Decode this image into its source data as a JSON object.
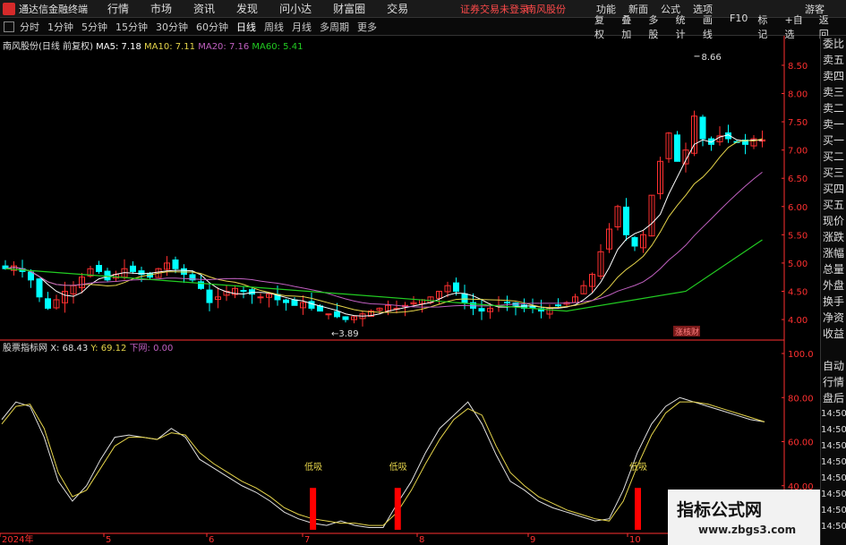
{
  "menubar": {
    "app_title": "通达信金融终端",
    "items": [
      "行情",
      "市场",
      "资讯",
      "发现",
      "问小达",
      "财富圈",
      "交易"
    ],
    "alert": "证券交易未登录",
    "stock_name": "南风股份",
    "right_items": [
      "功能",
      "新面",
      "公式",
      "选项"
    ],
    "guest": "游客"
  },
  "toolbar": {
    "periods": [
      "分时",
      "1分钟",
      "5分钟",
      "15分钟",
      "30分钟",
      "60分钟",
      "日线",
      "周线",
      "月线",
      "多周期",
      "更多"
    ],
    "active": "日线",
    "right_items": [
      "复权",
      "叠加",
      "多股",
      "统计",
      "画线",
      "F10",
      "标记",
      "+自选",
      "返回"
    ]
  },
  "main_info": {
    "name": "南风股份(日线 前复权)",
    "ma5": "MA5: 7.18",
    "ma10": "MA10: 7.11",
    "ma20": "MA20: 7.16",
    "ma60": "MA60: 5.41"
  },
  "sub_info": {
    "name": "股票指标网",
    "x": "X: 68.43",
    "y": "Y: 69.12",
    "down": "下网: 0.00"
  },
  "annotations": {
    "high_label": "8.66",
    "low_label": "3.89",
    "badge": "涨核财",
    "signal_label": "低吸"
  },
  "price_axis": [
    "8.50",
    "8.00",
    "7.50",
    "7.00",
    "6.50",
    "6.00",
    "5.50",
    "5.00",
    "4.50",
    "4.00"
  ],
  "osc_axis": [
    "100.0",
    "80.00",
    "60.00",
    "40.00"
  ],
  "date_axis": [
    "2024年",
    "5",
    "6",
    "7",
    "8",
    "9",
    "10"
  ],
  "side_panel": [
    "委比",
    "卖五",
    "卖四",
    "卖三",
    "卖二",
    "卖一",
    "买一",
    "买二",
    "买三",
    "买四",
    "买五",
    "现价",
    "涨跌",
    "涨幅",
    "总量",
    "外盘",
    "换手",
    "净资",
    "收益",
    "",
    "自动",
    "行情",
    "盘后",
    "14:50",
    "14:50",
    "14:50",
    "14:50",
    "14:50",
    "14:50",
    "14:50",
    "14:50"
  ],
  "watermark": {
    "title": "指标公式网",
    "url": "www.zbgs3.com"
  },
  "colors": {
    "up": "#ff3030",
    "down": "#00ffff",
    "ma5": "#ffffff",
    "ma10": "#e5d44a",
    "ma20": "#c060c0",
    "ma60": "#22cc22",
    "x_line": "#e0e0e0",
    "y_line": "#e5d44a",
    "signal": "#ff0000",
    "axis": "#ff3030"
  },
  "chart_data": [
    {
      "type": "candlestick",
      "title": "南风股份(日线 前复权)",
      "ylim": [
        3.7,
        8.8
      ],
      "price_high": 8.66,
      "price_low": 3.89,
      "x_labels": [
        "2024年",
        "5",
        "6",
        "7",
        "8",
        "9",
        "10"
      ],
      "closes": [
        4.9,
        4.95,
        4.85,
        4.7,
        4.4,
        4.2,
        4.35,
        4.5,
        4.6,
        4.75,
        4.9,
        4.85,
        4.7,
        4.8,
        4.9,
        4.85,
        4.8,
        4.75,
        4.9,
        5.0,
        4.9,
        4.8,
        4.7,
        4.55,
        4.3,
        4.4,
        4.5,
        4.55,
        4.5,
        4.45,
        4.4,
        4.45,
        4.35,
        4.3,
        4.25,
        4.3,
        4.2,
        4.15,
        4.1,
        4.05,
        4.0,
        4.05,
        4.1,
        4.15,
        4.2,
        4.25,
        4.2,
        4.25,
        4.3,
        4.35,
        4.4,
        4.5,
        4.6,
        4.5,
        4.3,
        4.2,
        4.15,
        4.2,
        4.25,
        4.3,
        4.25,
        4.2,
        4.2,
        4.15,
        4.2,
        4.25,
        4.3,
        4.4,
        4.6,
        4.8,
        5.2,
        5.6,
        6.0,
        5.5,
        5.3,
        5.5,
        6.2,
        6.8,
        7.3,
        6.8,
        7.0,
        7.6,
        7.2,
        7.1,
        7.25,
        7.2,
        7.15,
        7.1,
        7.2,
        7.18
      ],
      "ma60_points": [
        [
          0,
          4.9
        ],
        [
          40,
          4.45
        ],
        [
          66,
          4.15
        ],
        [
          80,
          4.5
        ],
        [
          89,
          5.41
        ]
      ],
      "legend": [
        "MA5: 7.18",
        "MA10: 7.11",
        "MA20: 7.16",
        "MA60: 5.41"
      ]
    },
    {
      "type": "line",
      "title": "股票指标网",
      "ylim": [
        20,
        100
      ],
      "y_ticks": [
        100,
        80,
        60,
        40
      ],
      "series": [
        {
          "name": "X",
          "values": [
            70,
            78,
            76,
            62,
            42,
            33,
            40,
            52,
            62,
            63,
            62,
            61,
            66,
            62,
            52,
            48,
            44,
            40,
            37,
            33,
            28,
            25,
            23,
            22,
            24,
            22,
            21,
            21,
            32,
            42,
            55,
            66,
            72,
            78,
            68,
            54,
            42,
            38,
            33,
            30,
            28,
            26,
            24,
            25,
            38,
            55,
            68,
            76,
            80,
            78,
            76,
            74,
            72,
            70,
            69
          ]
        },
        {
          "name": "Y",
          "values": [
            68,
            76,
            77,
            66,
            46,
            35,
            38,
            48,
            58,
            62,
            62,
            61,
            64,
            63,
            55,
            50,
            46,
            42,
            39,
            35,
            30,
            27,
            25,
            24,
            23,
            23,
            22,
            22,
            28,
            38,
            50,
            61,
            70,
            75,
            72,
            58,
            46,
            40,
            35,
            32,
            29,
            27,
            25,
            24,
            33,
            49,
            63,
            73,
            78,
            78,
            77,
            75,
            73,
            71,
            69
          ]
        }
      ],
      "signals": [
        {
          "label": "低吸",
          "index": 22
        },
        {
          "label": "低吸",
          "index": 28
        },
        {
          "label": "低吸",
          "index": 45
        }
      ],
      "current": {
        "X": 68.43,
        "Y": 69.12
      }
    }
  ]
}
